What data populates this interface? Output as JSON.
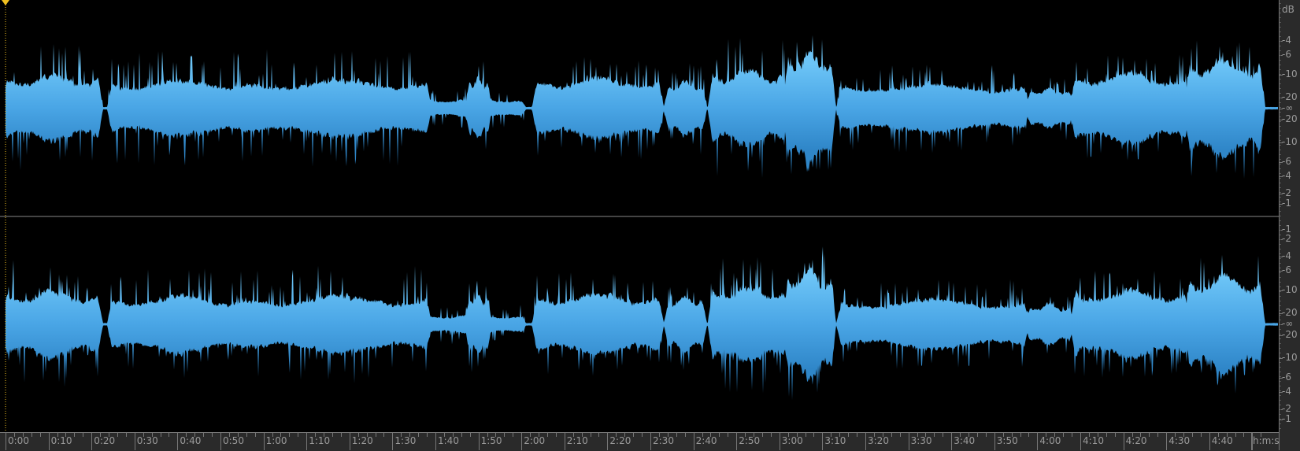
{
  "colors": {
    "wave_top": "#66c0f4",
    "wave_bottom": "#2f86c8",
    "playhead": "#f0c020",
    "background": "#000000"
  },
  "ruler": {
    "labels": [
      "0:00",
      "0:10",
      "0:20",
      "0:30",
      "0:40",
      "0:50",
      "1:00",
      "1:10",
      "1:20",
      "1:30",
      "1:40",
      "1:50",
      "2:00",
      "2:10",
      "2:20",
      "2:30",
      "2:40",
      "2:50",
      "3:00",
      "3:10",
      "3:20",
      "3:30",
      "3:40",
      "3:50",
      "4:00",
      "4:10",
      "4:20",
      "4:30",
      "4:40"
    ],
    "unit_label": "h:m:s"
  },
  "db_scale": {
    "unit": "dB",
    "channel1": [
      "-4",
      "-6",
      "-10",
      "-20",
      "-∞",
      "-20",
      "-10",
      "-6",
      "-4",
      "-2",
      "-1"
    ],
    "channel2": [
      "-1",
      "-2",
      "-4",
      "-6",
      "-10",
      "-20",
      "-∞",
      "-20",
      "-10",
      "-6",
      "-4",
      "-2",
      "-1"
    ]
  },
  "waveform": {
    "duration_s": 296,
    "segments": [
      {
        "start": 0.3,
        "end": 21.5,
        "amp": 0.33,
        "peak": 0.6
      },
      {
        "start": 24.8,
        "end": 57,
        "amp": 0.28,
        "peak": 0.55
      },
      {
        "start": 57.5,
        "end": 98,
        "amp": 0.28,
        "peak": 0.55
      },
      {
        "start": 98.4,
        "end": 120,
        "amp": 0.09,
        "peak": 0.2
      },
      {
        "start": 108,
        "end": 112,
        "amp": 0.3,
        "peak": 0.45
      },
      {
        "start": 123.6,
        "end": 152,
        "amp": 0.3,
        "peak": 0.48
      },
      {
        "start": 154.3,
        "end": 162,
        "amp": 0.27,
        "peak": 0.45
      },
      {
        "start": 164.5,
        "end": 181,
        "amp": 0.38,
        "peak": 0.65
      },
      {
        "start": 182,
        "end": 192,
        "amp": 0.55,
        "peak": 0.75
      },
      {
        "start": 194.4,
        "end": 237,
        "amp": 0.24,
        "peak": 0.42
      },
      {
        "start": 238.4,
        "end": 247.4,
        "amp": 0.2,
        "peak": 0.3
      },
      {
        "start": 248.8,
        "end": 274.4,
        "amp": 0.34,
        "peak": 0.5
      },
      {
        "start": 275.4,
        "end": 291.8,
        "amp": 0.48,
        "peak": 0.66
      }
    ]
  }
}
